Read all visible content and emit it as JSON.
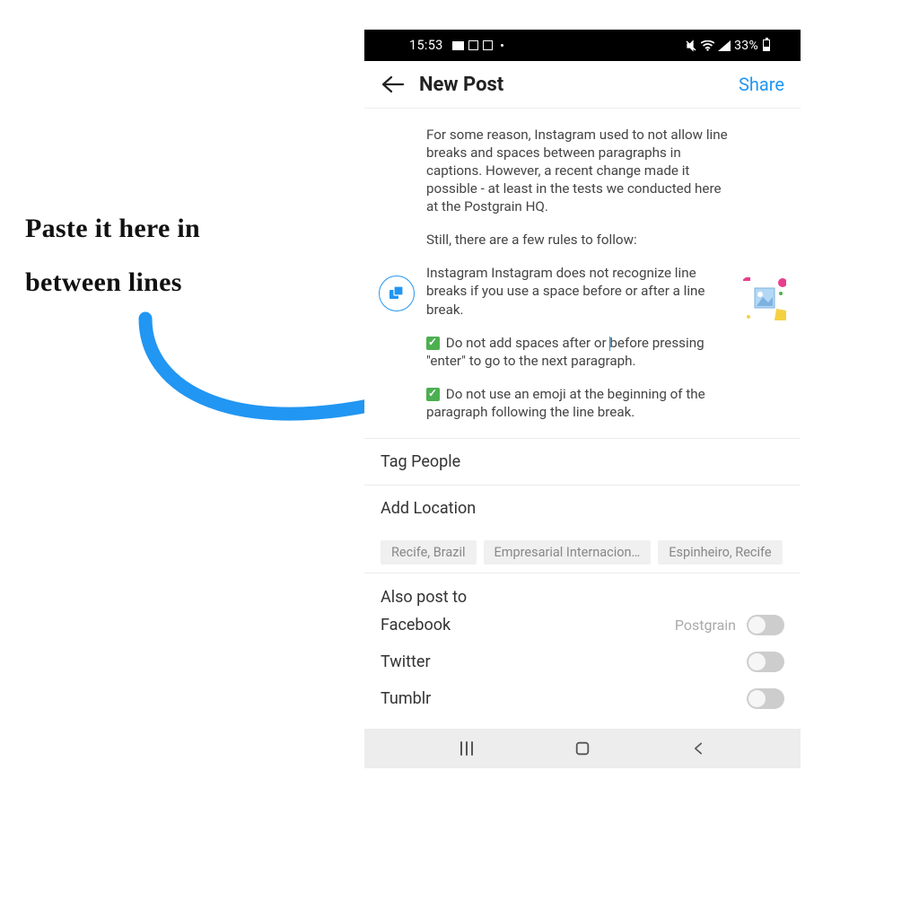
{
  "annotation": {
    "line1": "Paste it here in",
    "line2": "between lines"
  },
  "status_bar": {
    "time": "15:53",
    "battery_pct": "33%"
  },
  "app_header": {
    "title": "New Post",
    "share": "Share"
  },
  "caption": {
    "p1": "For some reason, Instagram used to not allow line breaks and spaces between paragraphs in captions. However, a recent change made it possible - at least in the tests we conducted here at the Postgrain HQ.",
    "p2": "Still, there are a few rules to follow:",
    "p3": "Instagram Instagram does not recognize line breaks if you use a space before or after a line break.",
    "p4a": " Do not add spaces after or ",
    "p4b": "before pressing \"enter\" to go to the next paragraph.",
    "p5": " Do not use an emoji at the beginning of the paragraph following the line break."
  },
  "list": {
    "tag_people": "Tag People",
    "add_location": "Add Location"
  },
  "location_chips": [
    "Recife, Brazil",
    "Empresarial Internacion…",
    "Espinheiro, Recife"
  ],
  "cross_post": {
    "heading": "Also post to",
    "items": [
      {
        "label": "Facebook",
        "sublabel": "Postgrain"
      },
      {
        "label": "Twitter",
        "sublabel": ""
      },
      {
        "label": "Tumblr",
        "sublabel": ""
      }
    ]
  }
}
